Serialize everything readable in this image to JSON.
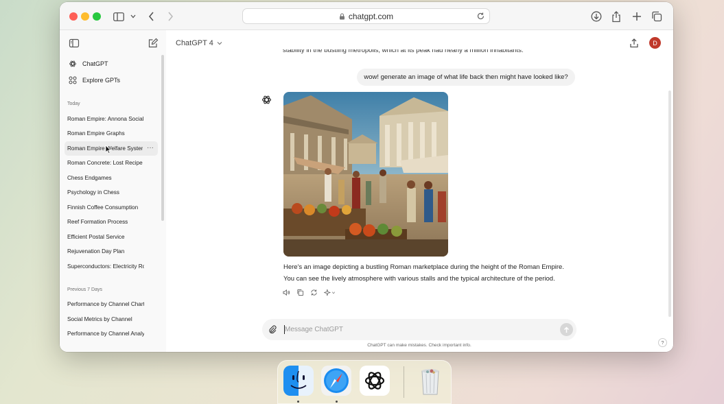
{
  "browser": {
    "url": "chatgpt.com"
  },
  "sidebar": {
    "nav": [
      {
        "label": "ChatGPT",
        "icon": "chatgpt-logo-icon"
      },
      {
        "label": "Explore GPTs",
        "icon": "grid-icon"
      }
    ],
    "today_label": "Today",
    "today": [
      "Roman Empire: Annona Social We",
      "Roman Empire Graphs",
      "Roman Empire Welfare System",
      "Roman Concrete: Lost Recipe",
      "Chess Endgames",
      "Psychology in Chess",
      "Finnish Coffee Consumption",
      "Reef Formation Process",
      "Efficient Postal Service",
      "Rejuvenation Day Plan",
      "Superconductors: Electricity Rolls"
    ],
    "prev7_label": "Previous 7 Days",
    "prev7": [
      "Performance by Channel Chart",
      "Social Metrics by Channel",
      "Performance by Channel Analysis"
    ],
    "active_more": "···"
  },
  "header": {
    "model": "ChatGPT 4",
    "avatar_initial": "D"
  },
  "chat": {
    "cut_off_text": "stability in the bustling metropolis, which at its peak had nearly a million inhabitants.",
    "user_message": "wow! generate an image of what life back then might have looked like?",
    "reply_line1": "Here's an image depicting a bustling Roman marketplace during the height of the Roman Empire.",
    "reply_line2": "You can see the lively atmosphere with various stalls and the typical architecture of the period."
  },
  "composer": {
    "placeholder": "Message ChatGPT",
    "disclaimer": "ChatGPT can make mistakes. Check important info.",
    "help": "?"
  },
  "dock": {
    "apps": [
      "Finder",
      "Safari",
      "ChatGPT",
      "Trash"
    ]
  }
}
